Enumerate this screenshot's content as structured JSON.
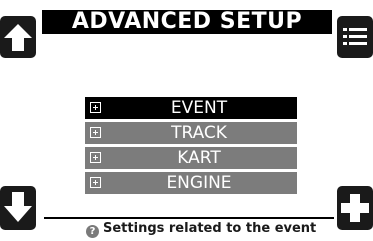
{
  "header": {
    "title": "ADVANCED SETUP"
  },
  "buttons": {
    "up_icon": "arrow-up-icon",
    "menu_icon": "list-menu-icon",
    "down_icon": "arrow-down-icon",
    "add_icon": "plus-icon"
  },
  "menu": {
    "items": [
      {
        "label": "EVENT",
        "selected": true
      },
      {
        "label": "TRACK",
        "selected": false
      },
      {
        "label": "KART",
        "selected": false
      },
      {
        "label": "ENGINE",
        "selected": false
      }
    ]
  },
  "status": {
    "icon_glyph": "?",
    "text": "Settings related to the event"
  },
  "colors": {
    "background": "#ffffff",
    "selected_item": "#000000",
    "unselected_item": "#7c7c7c",
    "title_bg": "#000000"
  }
}
